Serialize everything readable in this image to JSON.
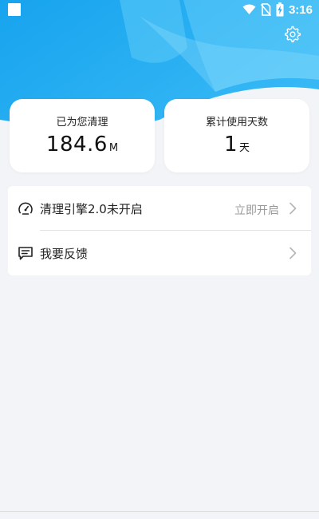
{
  "status_bar": {
    "time": "3:16",
    "icons": [
      "notification-square-icon",
      "wifi-icon",
      "no-sim-icon",
      "battery-charging-icon"
    ]
  },
  "header": {
    "settings_icon": "gear-icon",
    "bg_colors": [
      "#1fa8f0",
      "#47c2f7",
      "#7dd6fb"
    ]
  },
  "stats": {
    "cleaned": {
      "label": "已为您清理",
      "value": "184.6",
      "unit": "M"
    },
    "days": {
      "label": "累计使用天数",
      "value": "1",
      "unit": "天"
    }
  },
  "menu": {
    "items": [
      {
        "label": "清理引擎2.0未开启",
        "action": "立即开启",
        "icon": "speedometer-icon"
      },
      {
        "label": "我要反馈",
        "action": "",
        "icon": "feedback-message-icon"
      }
    ]
  },
  "colors": {
    "accent": "#1fa8f0",
    "background": "#f3f4f7",
    "card": "#ffffff",
    "muted_text": "#999999"
  }
}
